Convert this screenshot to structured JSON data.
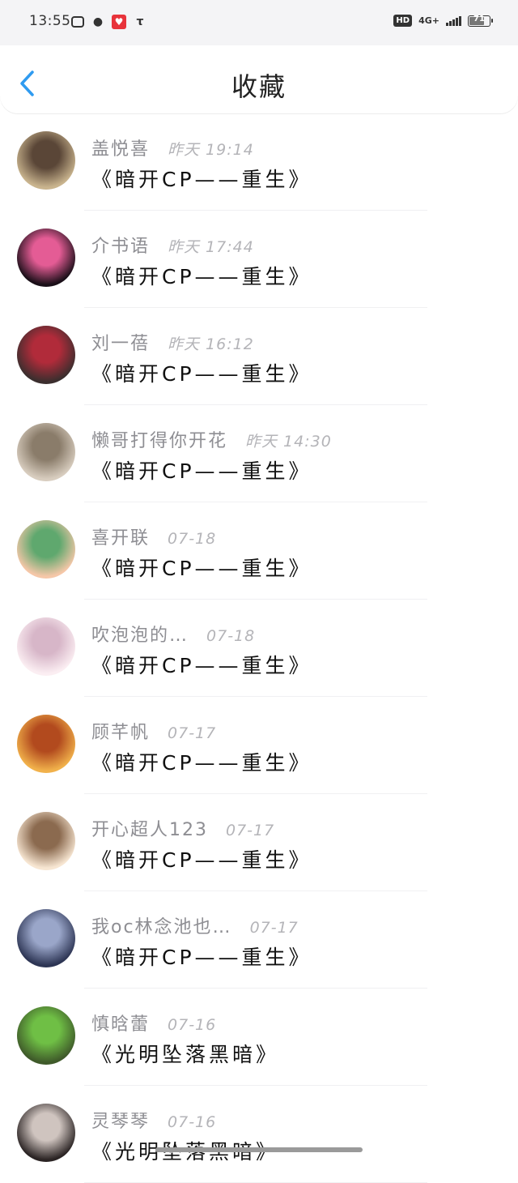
{
  "status_bar": {
    "time": "13:55",
    "left_icons": [
      "tv-icon",
      "bird-icon",
      "heart-app-icon",
      "taobao-icon"
    ],
    "hd_label": "HD",
    "network_label": "4G+",
    "battery_level": "71",
    "battery_fraction": 0.71
  },
  "header": {
    "back_icon": "chevron-left-icon",
    "title": "收藏",
    "accent_color": "#2f9bf0"
  },
  "items": [
    {
      "author": "盖悦喜",
      "time": "昨天 19:14",
      "title": "《暗开CP——重生》",
      "avatar_colors": [
        "#c9b48e",
        "#5a4637"
      ]
    },
    {
      "author": "介书语",
      "time": "昨天 17:44",
      "title": "《暗开CP——重生》",
      "avatar_colors": [
        "#1a0f18",
        "#e45c95"
      ]
    },
    {
      "author": "刘一蓓",
      "time": "昨天 16:12",
      "title": "《暗开CP——重生》",
      "avatar_colors": [
        "#3b2e2e",
        "#b12b3a"
      ]
    },
    {
      "author": "懒哥打得你开花",
      "time": "昨天 14:30",
      "title": "《暗开CP——重生》",
      "avatar_colors": [
        "#d8cdbf",
        "#8a7c6a"
      ]
    },
    {
      "author": "喜开联",
      "time": "07-18",
      "title": "《暗开CP——重生》",
      "avatar_colors": [
        "#f5c7a8",
        "#5fa86e"
      ]
    },
    {
      "author": "吹泡泡的…",
      "time": "07-18",
      "title": "《暗开CP——重生》",
      "avatar_colors": [
        "#fbeef2",
        "#d7b6c8"
      ]
    },
    {
      "author": "顾芊帆",
      "time": "07-17",
      "title": "《暗开CP——重生》",
      "avatar_colors": [
        "#f1b14b",
        "#b24a1e"
      ]
    },
    {
      "author": "开心超人123",
      "time": "07-17",
      "title": "《暗开CP——重生》",
      "avatar_colors": [
        "#f7e6d2",
        "#8b6a4f"
      ]
    },
    {
      "author": "我oc林念池也…",
      "time": "07-17",
      "title": "《暗开CP——重生》",
      "avatar_colors": [
        "#2d3554",
        "#9aa6c9"
      ]
    },
    {
      "author": "慎晗蕾",
      "time": "07-16",
      "title": "《光明坠落黑暗》",
      "avatar_colors": [
        "#3f5a2a",
        "#6fbf45"
      ]
    },
    {
      "author": "灵琴琴",
      "time": "07-16",
      "title": "《光明坠落黑暗》",
      "avatar_colors": [
        "#2b2424",
        "#cfc4bf"
      ]
    }
  ]
}
